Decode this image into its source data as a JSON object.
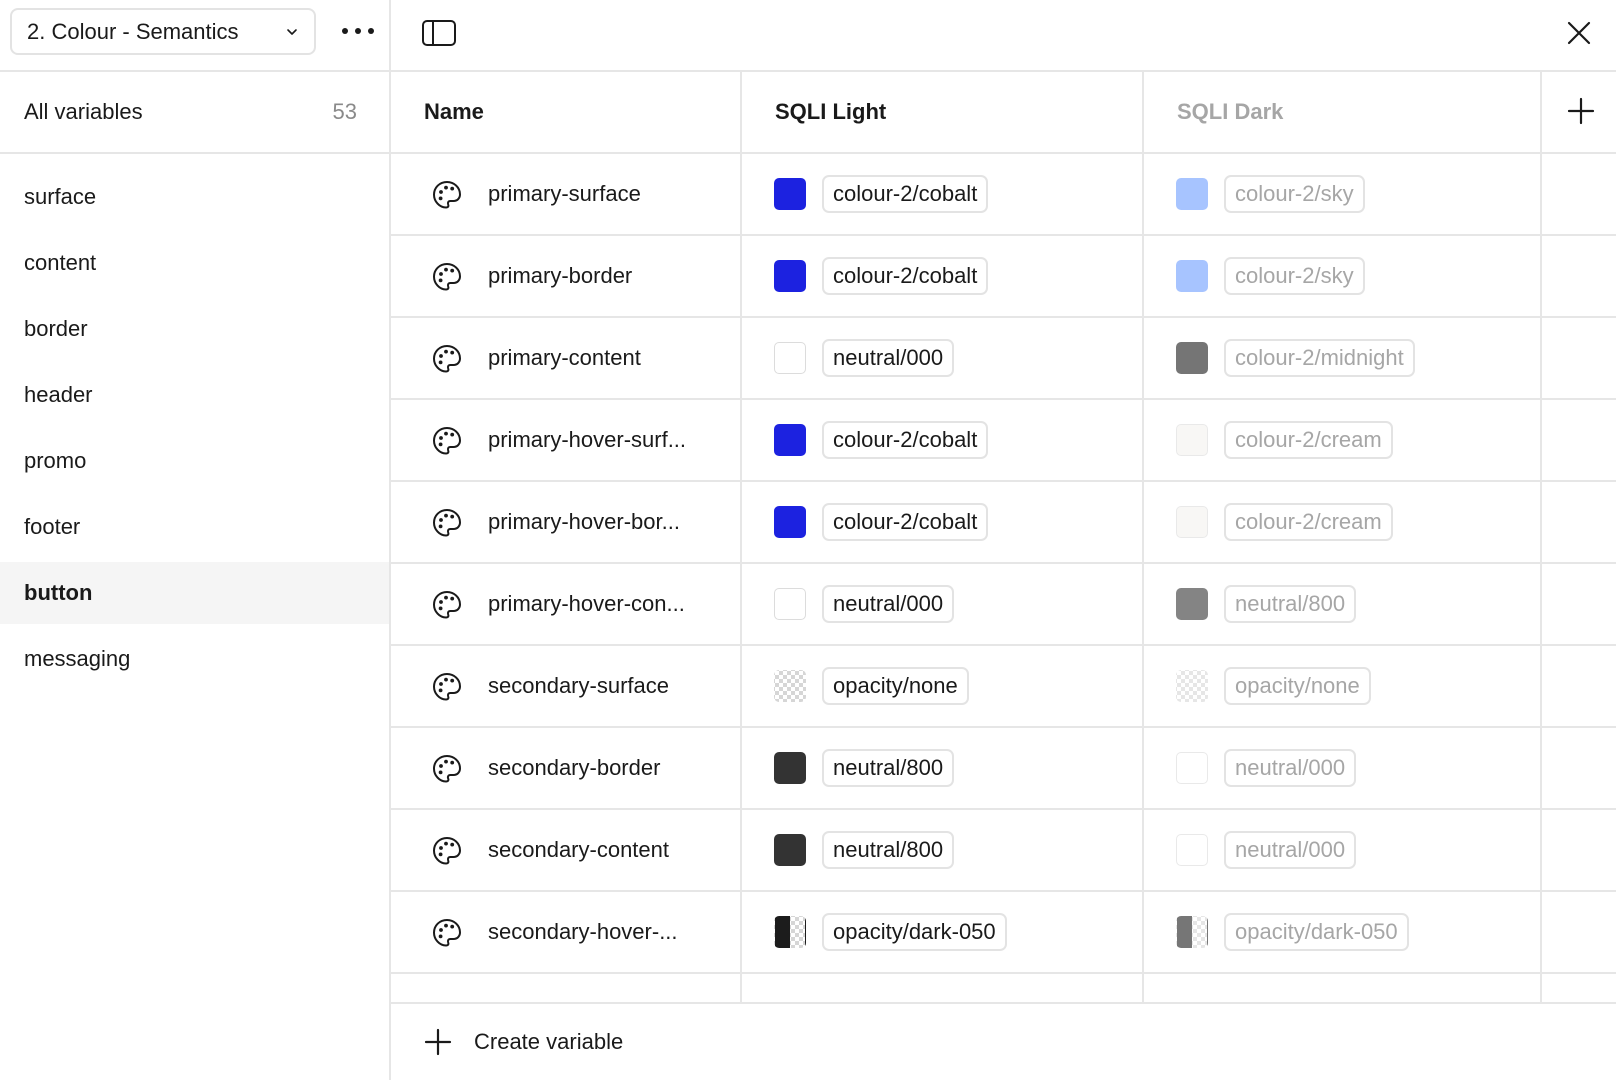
{
  "sidebar": {
    "collection_label": "2. Colour - Semantics",
    "all_variables_label": "All variables",
    "all_variables_count": "53",
    "groups": [
      {
        "label": "surface"
      },
      {
        "label": "content"
      },
      {
        "label": "border"
      },
      {
        "label": "header"
      },
      {
        "label": "promo"
      },
      {
        "label": "footer"
      },
      {
        "label": "button",
        "active": true
      },
      {
        "label": "messaging"
      }
    ]
  },
  "table": {
    "columns": {
      "name": "Name",
      "light": "SQLI Light",
      "dark": "SQLI Dark"
    },
    "rows": [
      {
        "name": "primary-surface",
        "light": {
          "value": "colour-2/cobalt",
          "color": "#1c22e0"
        },
        "dark": {
          "value": "colour-2/sky",
          "color": "#6d9dff"
        }
      },
      {
        "name": "primary-border",
        "light": {
          "value": "colour-2/cobalt",
          "color": "#1c22e0"
        },
        "dark": {
          "value": "colour-2/sky",
          "color": "#6d9dff"
        }
      },
      {
        "name": "primary-content",
        "light": {
          "value": "neutral/000",
          "color": "#ffffff"
        },
        "dark": {
          "value": "colour-2/midnight",
          "color": "#1b1b1b"
        }
      },
      {
        "name": "primary-hover-surf...",
        "light": {
          "value": "colour-2/cobalt",
          "color": "#1c22e0"
        },
        "dark": {
          "value": "colour-2/cream",
          "color": "#f4f3f0"
        }
      },
      {
        "name": "primary-hover-bor...",
        "light": {
          "value": "colour-2/cobalt",
          "color": "#1c22e0"
        },
        "dark": {
          "value": "colour-2/cream",
          "color": "#f4f3f0"
        }
      },
      {
        "name": "primary-hover-con...",
        "light": {
          "value": "neutral/000",
          "color": "#ffffff"
        },
        "dark": {
          "value": "neutral/800",
          "color": "#333333"
        }
      },
      {
        "name": "secondary-surface",
        "light": {
          "value": "opacity/none",
          "color": "transparent"
        },
        "dark": {
          "value": "opacity/none",
          "color": "transparent"
        }
      },
      {
        "name": "secondary-border",
        "light": {
          "value": "neutral/800",
          "color": "#333333"
        },
        "dark": {
          "value": "neutral/000",
          "color": "#ffffff"
        }
      },
      {
        "name": "secondary-content",
        "light": {
          "value": "neutral/800",
          "color": "#333333"
        },
        "dark": {
          "value": "neutral/000",
          "color": "#ffffff"
        }
      },
      {
        "name": "secondary-hover-...",
        "light": {
          "value": "opacity/dark-050",
          "color": "semi-dark"
        },
        "dark": {
          "value": "opacity/dark-050",
          "color": "semi-dark"
        }
      }
    ]
  },
  "footer": {
    "create_label": "Create variable"
  },
  "icons": {
    "collection_chevron": "chevron-down-icon",
    "more": "more-horizontal-icon",
    "sidebar_toggle": "sidebar-toggle-icon",
    "close": "close-icon",
    "add_mode": "plus-icon",
    "variable_type": "palette-icon",
    "create": "plus-icon"
  }
}
